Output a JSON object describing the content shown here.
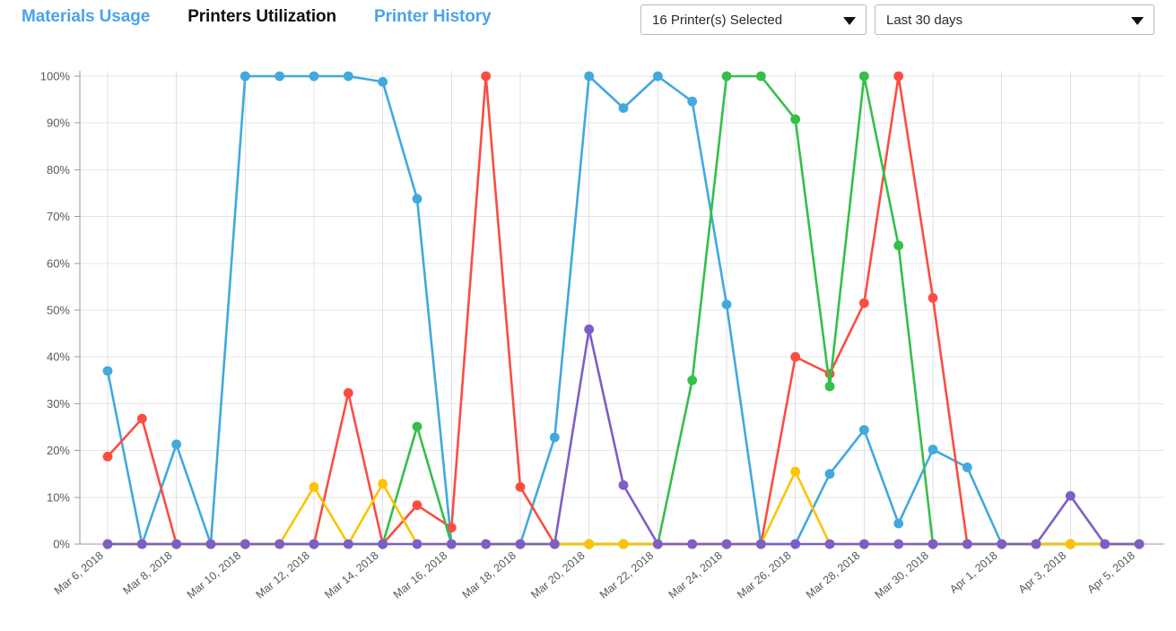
{
  "header": {
    "tabs": [
      {
        "label": "Materials Usage",
        "active": false
      },
      {
        "label": "Printers Utilization",
        "active": true
      },
      {
        "label": "Printer History",
        "active": false
      }
    ],
    "printer_select": {
      "value": "16 Printer(s) Selected",
      "icon": "chevron-down-icon"
    },
    "range_select": {
      "value": "Last 30 days",
      "icon": "chevron-down-icon"
    }
  },
  "chart_data": {
    "type": "line",
    "title": "",
    "xlabel": "",
    "ylabel": "",
    "ylim": [
      0,
      100
    ],
    "ytick_labels": [
      "0%",
      "10%",
      "20%",
      "30%",
      "40%",
      "50%",
      "60%",
      "70%",
      "80%",
      "90%",
      "100%"
    ],
    "ytick_values": [
      0,
      10,
      20,
      30,
      40,
      50,
      60,
      70,
      80,
      90,
      100
    ],
    "grid": true,
    "legend": "none",
    "x": [
      "Mar 6, 2018",
      "Mar 7, 2018",
      "Mar 8, 2018",
      "Mar 9, 2018",
      "Mar 10, 2018",
      "Mar 11, 2018",
      "Mar 12, 2018",
      "Mar 13, 2018",
      "Mar 14, 2018",
      "Mar 15, 2018",
      "Mar 16, 2018",
      "Mar 17, 2018",
      "Mar 18, 2018",
      "Mar 19, 2018",
      "Mar 20, 2018",
      "Mar 21, 2018",
      "Mar 22, 2018",
      "Mar 23, 2018",
      "Mar 24, 2018",
      "Mar 25, 2018",
      "Mar 26, 2018",
      "Mar 27, 2018",
      "Mar 28, 2018",
      "Mar 29, 2018",
      "Mar 30, 2018",
      "Mar 31, 2018",
      "Apr 1, 2018",
      "Apr 2, 2018",
      "Apr 3, 2018",
      "Apr 4, 2018",
      "Apr 5, 2018"
    ],
    "xtick_labels": [
      "Mar 6, 2018",
      "Mar 8, 2018",
      "Mar 10, 2018",
      "Mar 12, 2018",
      "Mar 14, 2018",
      "Mar 16, 2018",
      "Mar 18, 2018",
      "Mar 20, 2018",
      "Mar 22, 2018",
      "Mar 24, 2018",
      "Mar 26, 2018",
      "Mar 28, 2018",
      "Mar 30, 2018",
      "Apr 1, 2018",
      "Apr 3, 2018",
      "Apr 5, 2018"
    ],
    "xtick_indices": [
      0,
      2,
      4,
      6,
      8,
      10,
      12,
      14,
      16,
      18,
      20,
      22,
      24,
      26,
      28,
      30
    ],
    "series": [
      {
        "name": "blue",
        "color": "#41a9de",
        "values": [
          37.0,
          0,
          21.3,
          0,
          100,
          100,
          100,
          100,
          98.8,
          73.8,
          0,
          0,
          0,
          22.8,
          100,
          93.2,
          100,
          94.6,
          51.2,
          0,
          0,
          15.0,
          24.4,
          4.4,
          20.2,
          16.4,
          0,
          0,
          0,
          0,
          0
        ]
      },
      {
        "name": "red",
        "color": "#fb4d42",
        "values": [
          18.7,
          26.8,
          0,
          0,
          0,
          0,
          0,
          32.3,
          0,
          8.3,
          3.5,
          100,
          12.2,
          0,
          0,
          0,
          0,
          0,
          0,
          0,
          40.0,
          36.4,
          51.5,
          100,
          52.6,
          0,
          0,
          0,
          0,
          0,
          0
        ]
      },
      {
        "name": "green",
        "color": "#34bf49",
        "values": [
          0,
          0,
          0,
          0,
          0,
          0,
          0,
          0,
          0,
          25.1,
          0,
          0,
          0,
          0,
          0,
          0,
          0,
          35.0,
          100,
          100,
          90.8,
          33.7,
          100,
          63.8,
          0,
          0,
          0,
          0,
          0,
          0,
          0
        ]
      },
      {
        "name": "yellow",
        "color": "#fcc300",
        "values": [
          0,
          0,
          0,
          0,
          0,
          0,
          12.2,
          0,
          12.9,
          0,
          0,
          0,
          0,
          0,
          0,
          0,
          0,
          0,
          0,
          0,
          15.5,
          0,
          0,
          0,
          0,
          0,
          0,
          0,
          0,
          0,
          0
        ]
      },
      {
        "name": "purple",
        "color": "#7e5ec6",
        "values": [
          0,
          0,
          0,
          0,
          0,
          0,
          0,
          0,
          0,
          0,
          0,
          0,
          0,
          0,
          45.9,
          12.6,
          0,
          0,
          0,
          0,
          0,
          0,
          0,
          0,
          0,
          0,
          0,
          0,
          10.3,
          0,
          0
        ]
      }
    ]
  }
}
